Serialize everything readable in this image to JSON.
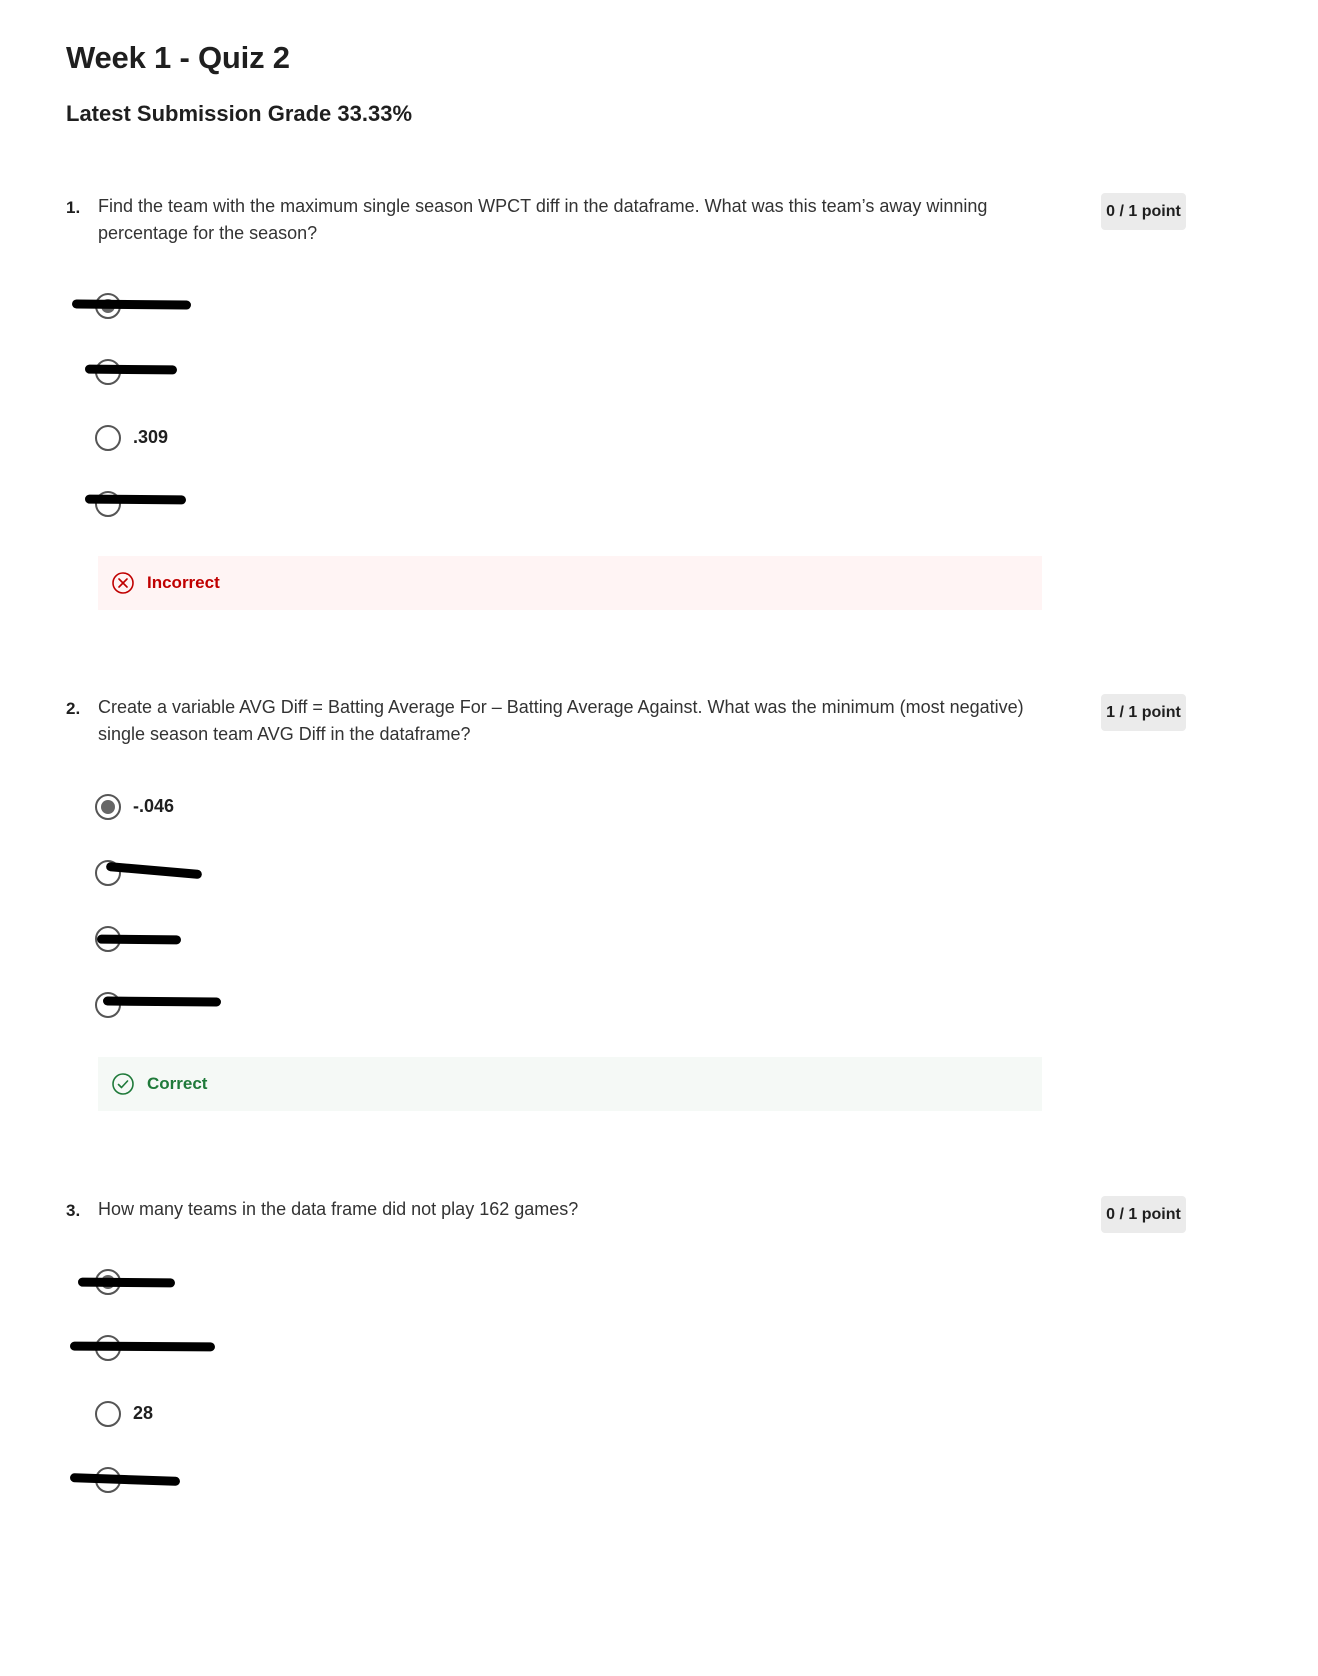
{
  "page": {
    "title": "Week 1 - Quiz 2",
    "grade": "Latest Submission Grade 33.33%"
  },
  "questions": [
    {
      "number": "1.",
      "text": "Find the team with the maximum single season WPCT diff in the dataframe. What was this team’s away winning percentage for the season?",
      "points": "0 / 1 point",
      "options": [
        {
          "label": "",
          "selected": true,
          "redacted": true
        },
        {
          "label": "",
          "selected": false,
          "redacted": true
        },
        {
          "label": ".309",
          "selected": false,
          "redacted": false
        },
        {
          "label": "",
          "selected": false,
          "redacted": true
        }
      ],
      "feedback": {
        "status": "incorrect",
        "label": "Incorrect",
        "icon": "x-circle-icon"
      }
    },
    {
      "number": "2.",
      "text": "Create a variable AVG Diff = Batting Average For – Batting Average Against. What was the minimum (most negative) single season team AVG Diff in the dataframe?",
      "points": "1 / 1 point",
      "options": [
        {
          "label": "-.046",
          "selected": true,
          "redacted": false
        },
        {
          "label": "",
          "selected": false,
          "redacted": true
        },
        {
          "label": "",
          "selected": false,
          "redacted": true
        },
        {
          "label": "",
          "selected": false,
          "redacted": true
        }
      ],
      "feedback": {
        "status": "correct",
        "label": "Correct",
        "icon": "check-circle-icon"
      }
    },
    {
      "number": "3.",
      "text": "How many teams in the data frame did not play 162 games?",
      "points": "0 / 1 point",
      "options": [
        {
          "label": "",
          "selected": true,
          "redacted": true
        },
        {
          "label": "",
          "selected": false,
          "redacted": true
        },
        {
          "label": "28",
          "selected": false,
          "redacted": false
        },
        {
          "label": "",
          "selected": false,
          "redacted": true
        }
      ]
    }
  ],
  "colors": {
    "incorrect": "#c00000",
    "correct": "#1f7a3a",
    "badge_bg": "#ebebeb"
  }
}
